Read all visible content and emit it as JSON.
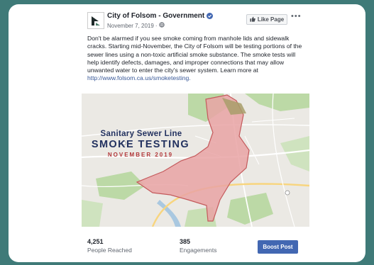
{
  "post": {
    "page_name": "City of Folsom - Government",
    "date": "November 7, 2019",
    "like_button_label": "Like Page",
    "more_label": "•••",
    "text": "Don't be alarmed if you see smoke coming from manhole lids and sidewalk cracks. Starting mid-November, the City of Folsom will be testing portions of the sewer lines using a non-toxic artificial smoke substance. The smoke tests will help identify defects, damages, and improper connections that may allow unwanted water to enter the city's sewer system. Learn more at",
    "link": "http://www.folsom.ca.us/smoketesting."
  },
  "map_image": {
    "title_line1": "Sanitary Sewer Line",
    "title_line2": "SMOKE TESTING",
    "title_line3": "NOVEMBER 2019",
    "colors": {
      "area_fill": "#e9a3a4",
      "area_stroke": "#c45a5c",
      "park_green": "#bcd9a6",
      "title_blue": "#22315f",
      "title_red": "#b2373a"
    }
  },
  "insights": {
    "people_reached_value": "4,251",
    "people_reached_label": "People Reached",
    "engagements_value": "385",
    "engagements_label": "Engagements",
    "boost_button_label": "Boost Post"
  },
  "icons": [
    "page-avatar-icon",
    "verified-badge-icon",
    "globe-icon",
    "like-thumb-icon",
    "more-options-icon"
  ]
}
